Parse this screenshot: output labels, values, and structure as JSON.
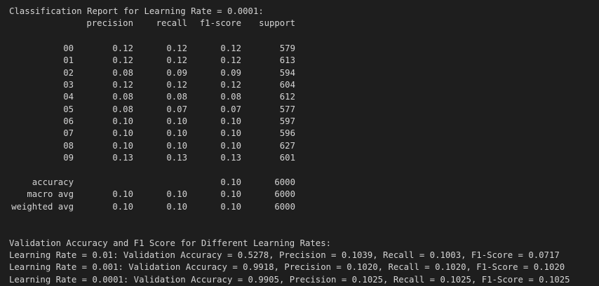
{
  "report": {
    "title": "Classification Report for Learning Rate = 0.0001:",
    "headers": {
      "precision": "precision",
      "recall": "recall",
      "f1": "f1-score",
      "support": "support"
    },
    "rows": [
      {
        "label": "00",
        "precision": "0.12",
        "recall": "0.12",
        "f1": "0.12",
        "support": "579"
      },
      {
        "label": "01",
        "precision": "0.12",
        "recall": "0.12",
        "f1": "0.12",
        "support": "613"
      },
      {
        "label": "02",
        "precision": "0.08",
        "recall": "0.09",
        "f1": "0.09",
        "support": "594"
      },
      {
        "label": "03",
        "precision": "0.12",
        "recall": "0.12",
        "f1": "0.12",
        "support": "604"
      },
      {
        "label": "04",
        "precision": "0.08",
        "recall": "0.08",
        "f1": "0.08",
        "support": "612"
      },
      {
        "label": "05",
        "precision": "0.08",
        "recall": "0.07",
        "f1": "0.07",
        "support": "577"
      },
      {
        "label": "06",
        "precision": "0.10",
        "recall": "0.10",
        "f1": "0.10",
        "support": "597"
      },
      {
        "label": "07",
        "precision": "0.10",
        "recall": "0.10",
        "f1": "0.10",
        "support": "596"
      },
      {
        "label": "08",
        "precision": "0.10",
        "recall": "0.10",
        "f1": "0.10",
        "support": "627"
      },
      {
        "label": "09",
        "precision": "0.13",
        "recall": "0.13",
        "f1": "0.13",
        "support": "601"
      }
    ],
    "summary": [
      {
        "label": "accuracy",
        "precision": "",
        "recall": "",
        "f1": "0.10",
        "support": "6000"
      },
      {
        "label": "macro avg",
        "precision": "0.10",
        "recall": "0.10",
        "f1": "0.10",
        "support": "6000"
      },
      {
        "label": "weighted avg",
        "precision": "0.10",
        "recall": "0.10",
        "f1": "0.10",
        "support": "6000"
      }
    ]
  },
  "validation": {
    "title": "Validation Accuracy and F1 Score for Different Learning Rates:",
    "lines": [
      "Learning Rate = 0.01: Validation Accuracy = 0.5278, Precision = 0.1039, Recall = 0.1003, F1-Score = 0.0717",
      "Learning Rate = 0.001: Validation Accuracy = 0.9918, Precision = 0.1020, Recall = 0.1020, F1-Score = 0.1020",
      "Learning Rate = 0.0001: Validation Accuracy = 0.9905, Precision = 0.1025, Recall = 0.1025, F1-Score = 0.1025"
    ]
  },
  "colors": {
    "background": "#1e1e1e",
    "text": "#d4d4d4"
  }
}
